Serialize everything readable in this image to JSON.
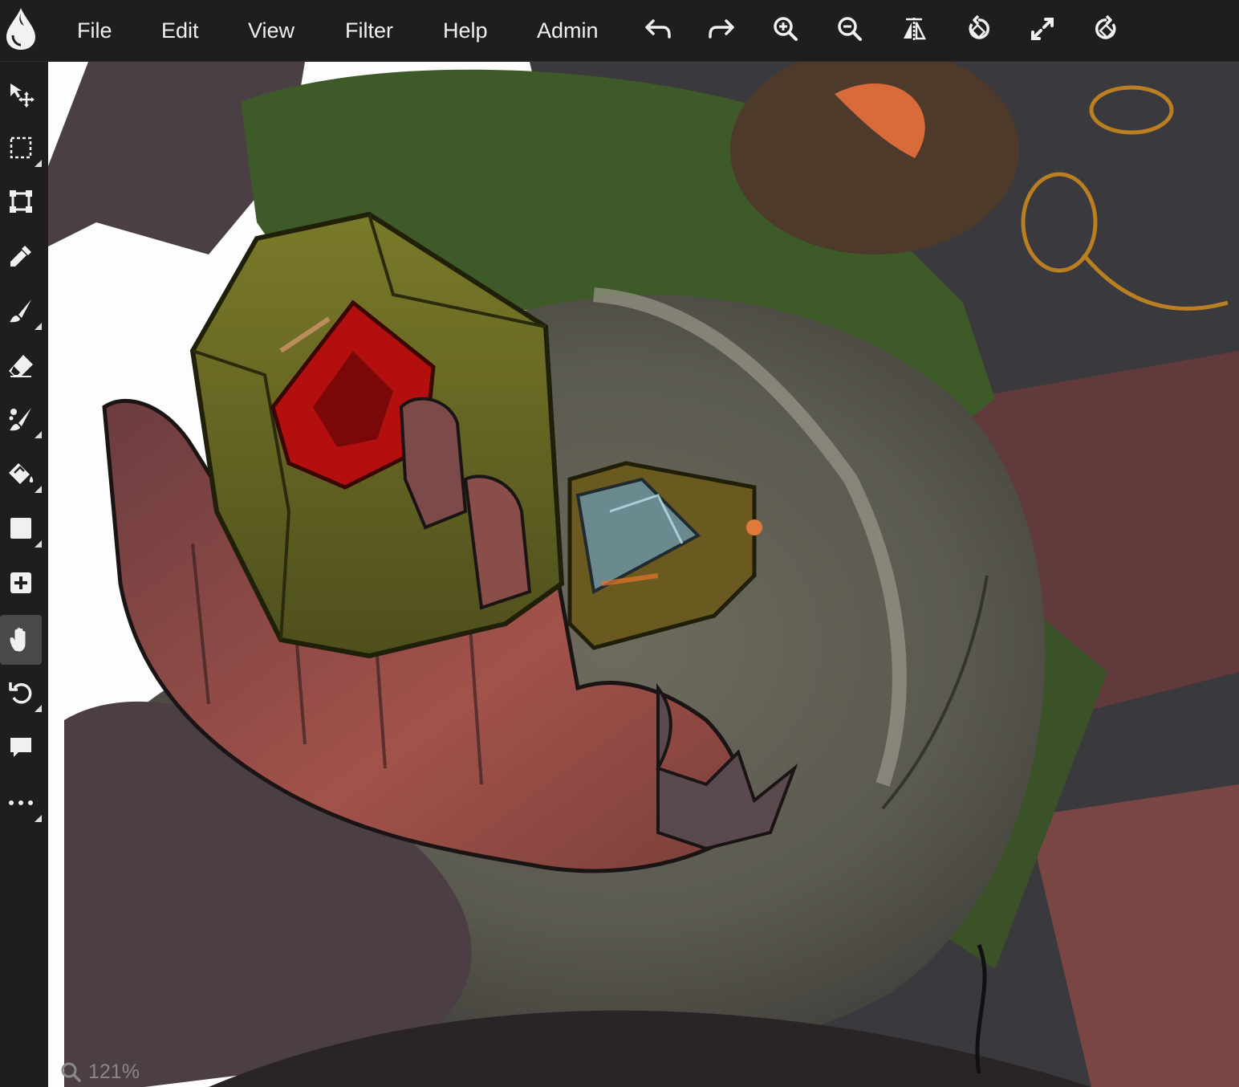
{
  "menu": {
    "file": "File",
    "edit": "Edit",
    "view": "View",
    "filter": "Filter",
    "help": "Help",
    "admin": "Admin"
  },
  "toolbar_icons": [
    "undo-icon",
    "redo-icon",
    "zoom-in-icon",
    "zoom-out-icon",
    "flip-icon",
    "rotate-left-icon",
    "fullscreen-icon",
    "rotate-right-icon"
  ],
  "tools": [
    "move-tool-icon",
    "select-icon",
    "transform-icon",
    "eyedropper-icon",
    "brush-icon",
    "eraser-icon",
    "smudge-icon",
    "fill-bucket-icon",
    "shape-icon",
    "add-layer-icon",
    "hand-icon",
    "rotate-canvas-icon",
    "comment-icon",
    "more-icon"
  ],
  "active_tool": "hand-icon",
  "status": {
    "zoom": "121%"
  },
  "colors": {
    "chrome": "#1e1e1e",
    "active_tool_bg": "#4a4a4a",
    "text": "#f0f0f0"
  }
}
